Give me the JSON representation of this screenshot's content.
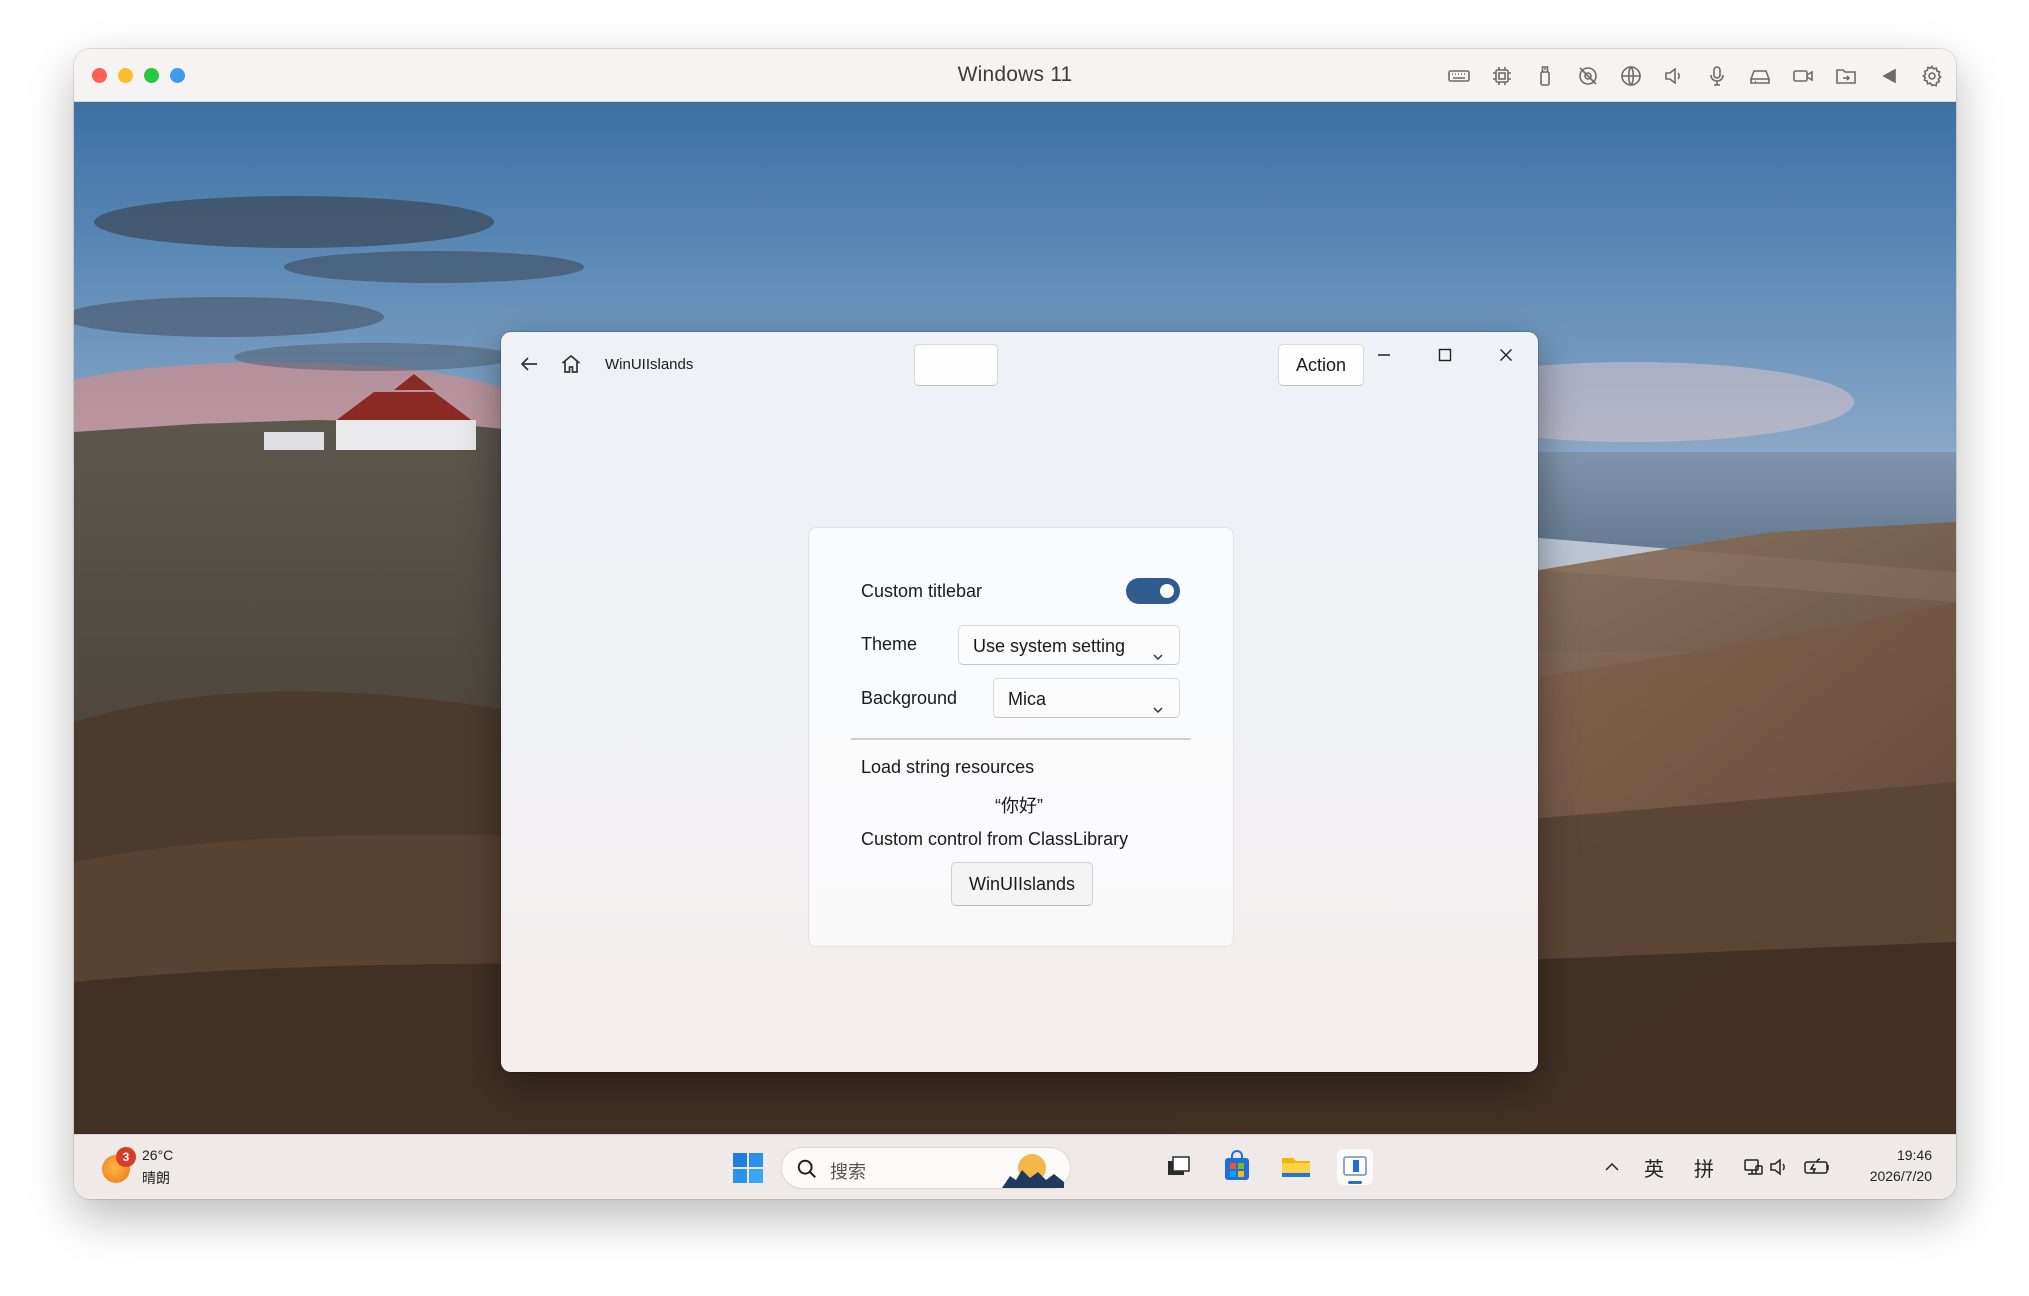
{
  "vm": {
    "title": "Windows 11",
    "toolbar_icons": [
      "keyboard-icon",
      "cpu-icon",
      "usb-icon",
      "camera-off-icon",
      "globe-icon",
      "speaker-icon",
      "microphone-icon",
      "drive-icon",
      "video-icon",
      "shared-folder-icon",
      "back-arrow-icon",
      "gear-icon"
    ]
  },
  "app": {
    "name": "WinUIIslands",
    "action_label": "Action",
    "settings": {
      "custom_titlebar_label": "Custom titlebar",
      "custom_titlebar_on": true,
      "theme_label": "Theme",
      "theme_value": "Use system setting",
      "background_label": "Background",
      "background_value": "Mica",
      "load_strings_label": "Load string resources",
      "loaded_string": "“你好”",
      "custom_control_label": "Custom control from ClassLibrary",
      "custom_control_button": "WinUIIslands"
    }
  },
  "taskbar": {
    "weather_badge": "3",
    "weather_temp": "26°C",
    "weather_condition": "晴朗",
    "search_placeholder": "搜索",
    "tray": {
      "ime_lang": "英",
      "ime_mode": "拼",
      "time": "19:46",
      "date": "2026/7/20"
    }
  },
  "colors": {
    "toggle_on": "#2f5b8e",
    "taskbar_active_underline": "#2f6dc4"
  }
}
